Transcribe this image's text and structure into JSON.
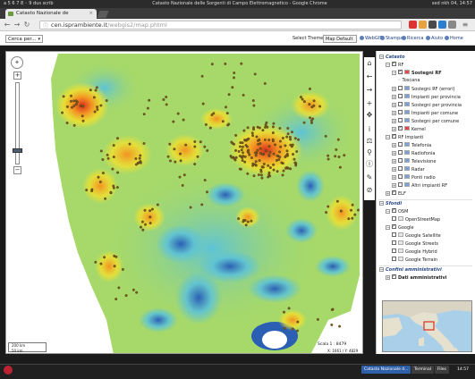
{
  "os_bar": {
    "left_text": "a 5 6 7 8 ◦ 9 dus scrib",
    "window_title": "Catasto Nazionale delle Sorgenti di Campo Elettromagnetico - Google Chrome",
    "clock": "sed nkh 04, 14:57"
  },
  "browser": {
    "tab_title": "Catasto Nazionale de",
    "tab_close": "×",
    "url_domain": "cen.isprambiente.it",
    "url_path": "/webgis2/map.phtml"
  },
  "app": {
    "search_select": "Cerca per...",
    "theme_label": "Select Theme",
    "theme_value": "Map Default",
    "links": [
      "WebGIS",
      "Stampa",
      "Ricerca",
      "Aiuto",
      "Home"
    ]
  },
  "map": {
    "pan_label": "N\nW + E\nS",
    "zoom_in": "+",
    "zoom_out": "−",
    "scale_small_1": "200 km",
    "scale_small_2": "50 km",
    "scale_text": "Scala 1 : 8479",
    "coords": "X: 1661 / Y: 4829"
  },
  "layers": {
    "groups": [
      {
        "label": "Catasto",
        "top": true
      },
      {
        "label": "RF",
        "indent": 1,
        "checked": true,
        "expander": "−"
      },
      {
        "label": "Sostegni RF",
        "indent": 2,
        "checked": true,
        "expander": "−",
        "bold": true
      },
      {
        "label": "Toscana",
        "indent": 3,
        "radio": true
      },
      {
        "label": "Sostegni RF (errori)",
        "indent": 2,
        "expander": "+"
      },
      {
        "label": "Impianti per provincia",
        "indent": 2,
        "expander": "+"
      },
      {
        "label": "Sostegni per provincia",
        "indent": 2,
        "expander": "+"
      },
      {
        "label": "Impianti per comune",
        "indent": 2,
        "expander": "+"
      },
      {
        "label": "Sostegni per comune",
        "indent": 2,
        "expander": "+"
      },
      {
        "label": "Kernel",
        "indent": 2,
        "checked": true,
        "expander": "+"
      },
      {
        "label": "RF Impianti",
        "indent": 1,
        "checked": true,
        "expander": "−"
      },
      {
        "label": "Telefonia",
        "indent": 2,
        "expander": "+"
      },
      {
        "label": "Radiofonia",
        "indent": 2,
        "expander": "+"
      },
      {
        "label": "Televisione",
        "indent": 2,
        "expander": "+"
      },
      {
        "label": "Radar",
        "indent": 2,
        "expander": "+"
      },
      {
        "label": "Ponti radio",
        "indent": 2,
        "expander": "+"
      },
      {
        "label": "Altri impianti RF",
        "indent": 2,
        "expander": "+"
      },
      {
        "label": "ELF",
        "indent": 1,
        "checked": true,
        "expander": "+"
      },
      {
        "label": "Sfondi",
        "top": true
      },
      {
        "label": "OSM",
        "indent": 1,
        "checked": true,
        "expander": "−"
      },
      {
        "label": "OpenStreetMap",
        "indent": 2
      },
      {
        "label": "Google",
        "indent": 1,
        "checked": true,
        "expander": "−"
      },
      {
        "label": "Google Satellite",
        "indent": 2
      },
      {
        "label": "Google Streets",
        "indent": 2
      },
      {
        "label": "Google Hybrid",
        "indent": 2
      },
      {
        "label": "Google Terrain",
        "indent": 2
      },
      {
        "label": "Confini amministrativi",
        "top": true
      },
      {
        "label": "Dati amministrativi",
        "indent": 1,
        "checked": true,
        "expander": "+",
        "bold": true
      }
    ]
  },
  "taskbar": {
    "items": [
      "Catasto Nazionale d...",
      "Terminal",
      "Files"
    ],
    "right": "14:57"
  },
  "colors": {
    "heat_low": "#2b5fb3",
    "heat_midlow": "#5ec3d6",
    "heat_mid": "#a6d96a",
    "heat_midhigh": "#f2e02e",
    "heat_high": "#f39222",
    "heat_peak": "#d7301f"
  }
}
